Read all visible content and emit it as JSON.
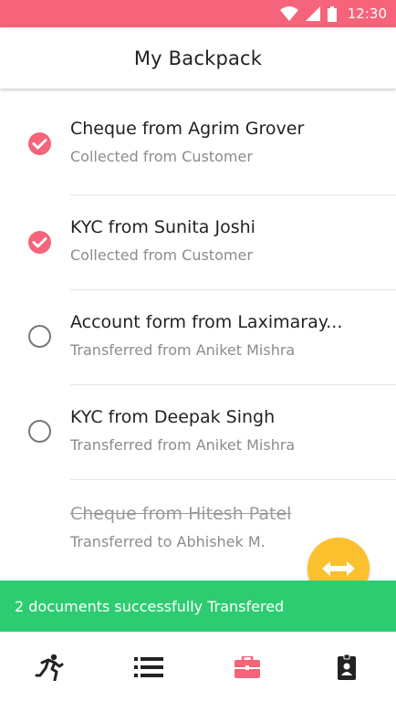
{
  "status_bar": {
    "time": "12:30"
  },
  "app_bar": {
    "title": "My Backpack"
  },
  "documents": [
    {
      "title": "Cheque from Agrim Grover",
      "subtitle": "Collected from Customer",
      "state": "checked"
    },
    {
      "title": "KYC from Sunita Joshi",
      "subtitle": "Collected from Customer",
      "state": "checked"
    },
    {
      "title": "Account form from Laximaray...",
      "subtitle": "Transferred from Aniket Mishra",
      "state": "unchecked"
    },
    {
      "title": "KYC from Deepak Singh",
      "subtitle": "Transferred from Aniket Mishra",
      "state": "unchecked"
    },
    {
      "title": "Cheque from Hitesh Patel",
      "subtitle": "Transferred to Abhishek M.",
      "state": "transferred"
    }
  ],
  "snackbar": {
    "message": "2 documents successfully Transfered"
  },
  "colors": {
    "accent": "#f5647a",
    "success": "#2ecc71",
    "fab": "#fbc02d"
  },
  "bottom_nav": [
    {
      "icon": "runner-icon",
      "active": false
    },
    {
      "icon": "list-icon",
      "active": false
    },
    {
      "icon": "briefcase-icon",
      "active": true
    },
    {
      "icon": "id-badge-icon",
      "active": false
    }
  ]
}
